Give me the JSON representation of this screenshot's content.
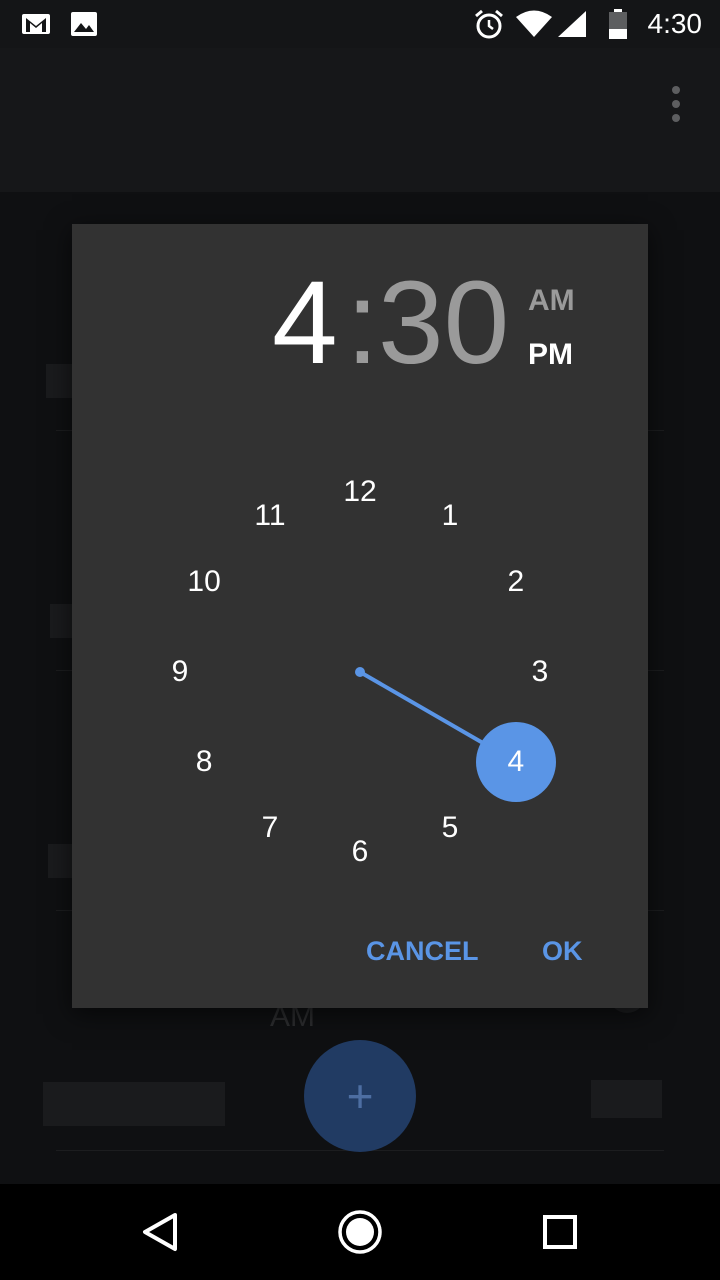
{
  "status_bar": {
    "time": "4:30",
    "icons": [
      "gmail-icon",
      "image-icon",
      "alarm-icon",
      "wifi-icon",
      "signal-icon",
      "battery-icon"
    ]
  },
  "background": {
    "alarm_am_label": "AM",
    "fab_label": "+"
  },
  "dialog": {
    "hour": "4",
    "colon": ":",
    "minute": "30",
    "am_label": "AM",
    "pm_label": "PM",
    "selected_period": "PM",
    "clock_numbers": [
      "12",
      "1",
      "2",
      "3",
      "4",
      "5",
      "6",
      "7",
      "8",
      "9",
      "10",
      "11"
    ],
    "selected_hour": "4",
    "cancel_label": "CANCEL",
    "ok_label": "OK"
  },
  "colors": {
    "accent": "#5a95e6",
    "dialog_bg": "#323232"
  }
}
